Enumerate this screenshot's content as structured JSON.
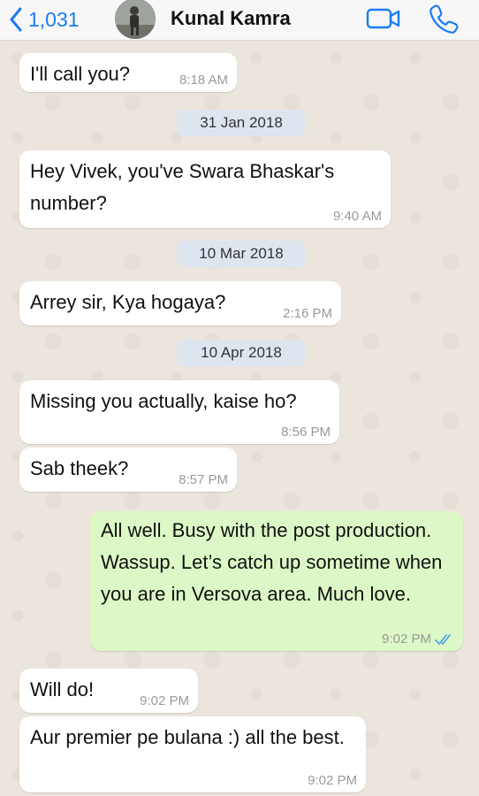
{
  "header": {
    "back_count": "1,031",
    "contact_name": "Kunal Kamra",
    "icons": [
      "back-chevron-icon",
      "video-call-icon",
      "phone-call-icon"
    ],
    "accent_color": "#1a7cf5"
  },
  "messages": [
    {
      "type": "in",
      "text": "I'll call you?",
      "time": "8:18 AM"
    },
    {
      "type": "date",
      "text": "31 Jan 2018"
    },
    {
      "type": "in",
      "text": "Hey Vivek, you've Swara Bhaskar's number?",
      "time": "9:40 AM"
    },
    {
      "type": "date",
      "text": "10 Mar 2018"
    },
    {
      "type": "in",
      "text": "Arrey sir, Kya hogaya?",
      "time": "2:16 PM"
    },
    {
      "type": "date",
      "text": "10 Apr 2018"
    },
    {
      "type": "in",
      "text": "Missing you actually, kaise ho?",
      "time": "8:56 PM"
    },
    {
      "type": "in",
      "text": "Sab theek?",
      "time": "8:57 PM"
    },
    {
      "type": "out",
      "text": "All well. Busy with the post production. Wassup. Let’s catch up sometime when you are in Versova area. Much love.",
      "time": "9:02 PM",
      "status": "read"
    },
    {
      "type": "in",
      "text": "Will do!",
      "time": "9:02 PM"
    },
    {
      "type": "in",
      "text": "Aur premier pe bulana :) all the best.",
      "time": "9:02 PM"
    }
  ],
  "colors": {
    "incoming_bubble": "#ffffff",
    "outgoing_bubble": "#dcf8c6",
    "chat_background": "#ece5dd",
    "date_chip": "#dde6ef",
    "read_ticks": "#4fa9e6"
  }
}
